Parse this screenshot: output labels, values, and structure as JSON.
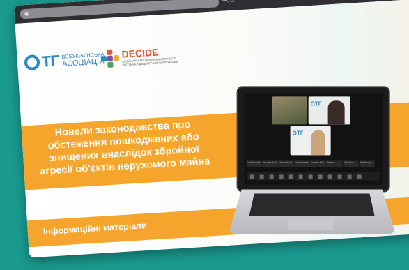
{
  "window": {
    "address_icon": "globe-icon",
    "search_glyph": "🔍",
    "home_glyph": "⌂",
    "minimize_glyph": "_",
    "maximize_glyph": "☐",
    "close_glyph": "✕"
  },
  "logos": {
    "otg": {
      "letters": "ТГ",
      "line1": "ВСЕУКРАЇНСЬКА",
      "line2": "АСОЦІАЦІЯ"
    },
    "decide": {
      "word": "DECIDE",
      "small": "ШВЕЙЦАРСЬКО-УКРАЇНСЬКИЙ ПРОЄКТ ПІДТРИМКИ ДЕЦЕНТРАЛІЗАЦІЇ В УКРАЇНІ"
    }
  },
  "slide": {
    "title_lines": [
      "Новели законодавства про",
      "обстеження пошкоджених або",
      "знищених внаслідок збройної",
      "агресії об'єктів нерухомого майна"
    ],
    "subtitle": "Інформаційні матеріали"
  },
  "laptop_screen": {
    "tile_logo": "ОТГ",
    "thumbs": [
      "Гав Мілена М",
      "Весняна Алла",
      "Олена Москв",
      "Галина Каміла",
      "Гайдабн Мілі",
      "Вадим",
      "SMK/ Інна",
      "Лілія Бідзюк"
    ]
  },
  "colors": {
    "accent": "#f5a52b",
    "brand_blue": "#2b86c4",
    "decide_orange": "#e0592d",
    "background": "#1a9a8f"
  }
}
